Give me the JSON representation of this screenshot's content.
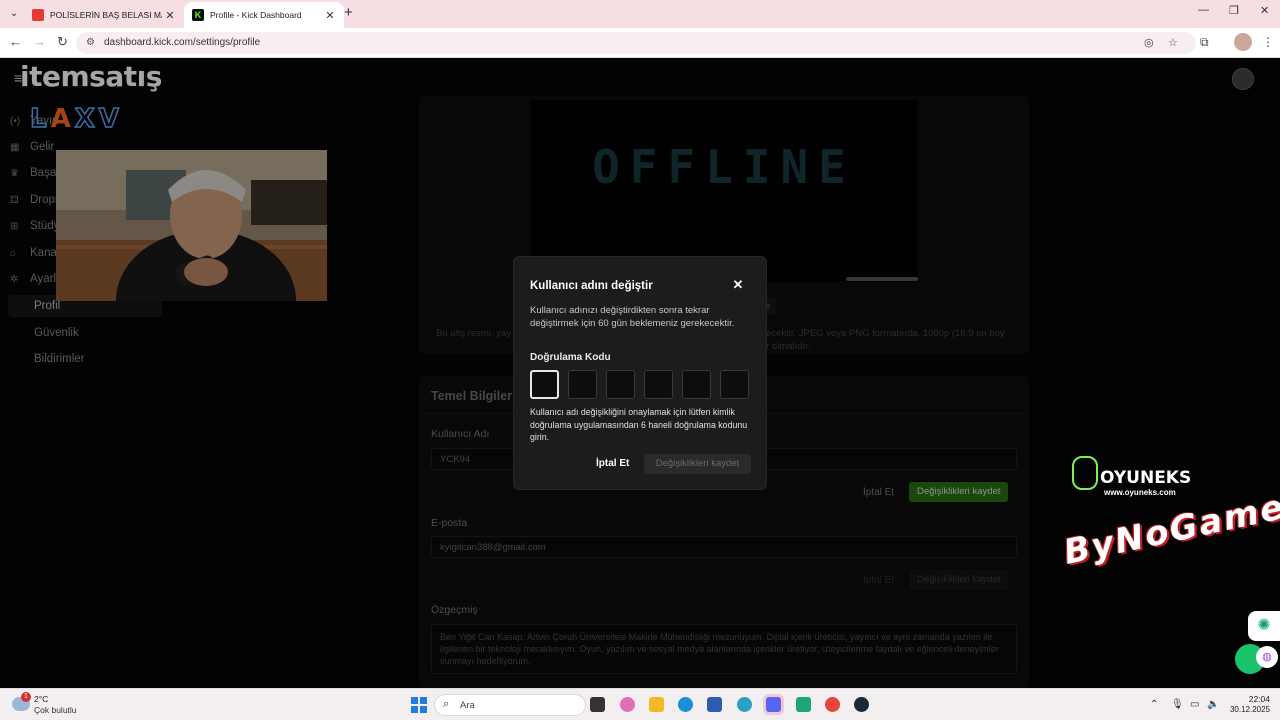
{
  "browser": {
    "tabs": [
      {
        "title": "POLİSLERİN BAŞ BELASI MAHMU",
        "icon": "youtube-icon"
      },
      {
        "title": "Profile - Kick Dashboard",
        "icon": "kick-icon"
      }
    ],
    "new_tab": "+",
    "url": "dashboard.kick.com/settings/profile"
  },
  "sidebar": {
    "items": [
      {
        "label": "Yayın",
        "icon": "broadcast-icon"
      },
      {
        "label": "Gelir",
        "icon": "chart-icon"
      },
      {
        "label": "Başarılar",
        "icon": "trophy-icon"
      },
      {
        "label": "Drops",
        "icon": "drops-icon"
      },
      {
        "label": "Stüdyo",
        "icon": "studio-icon"
      },
      {
        "label": "Kanal",
        "icon": "channel-icon"
      },
      {
        "label": "Ayarlar",
        "icon": "gear-icon"
      }
    ],
    "sub_items": [
      {
        "label": "Profil"
      },
      {
        "label": "Güvenlik"
      },
      {
        "label": "Bildirimler"
      }
    ]
  },
  "overlays": {
    "logo": "itemsatış",
    "laxv_l": "L",
    "laxv_a": "A",
    "laxv_xv": "XV",
    "oyuneks": "OYUNEKS",
    "oyuneks_url": "www.oyuneks.com",
    "bynogame": "ByNoGame"
  },
  "offline_banner": {
    "text": "OFFLINE"
  },
  "profile_page": {
    "banner_note_left": "Bu afiş resmi, yay",
    "banner_note_right": "ecektir. JPEG veya PNG formatında, 1080p (16:9 en boy",
    "banner_note_right2": "r olmalıdır.",
    "banner_btn_fragment": "le",
    "section_title": "Temel Bilgiler",
    "username_label": "Kullanıcı Adı",
    "username_value": "YCK94",
    "cancel": "İptal Et",
    "save": "Değişiklikleri kaydet",
    "email_label": "E-posta",
    "email_value": "kyigitcan388@gmail.com",
    "bio_label": "Özgeçmiş",
    "bio_value": "Ben Yiğit Can Kasap. Artvin Çoruh Üniversitesi Makine Mühendisliği mezunuyum. Dijital içerik üreticisi, yayıncı ve aynı zamanda yazılım ile ilgilenen bir teknoloji meraklısıyım. Oyun, yazılım ve sosyal medya alanlarında içerikler üretiyor; izleyicilerime faydalı ve eğlenceli deneyimler sunmayı hedefliyorum."
  },
  "modal": {
    "title": "Kullanıcı adını değiştir",
    "description": "Kullanıcı adınızı değiştirdikten sonra tekrar değiştirmek için 60 gün beklemeniz gerekecektir.",
    "code_label": "Doğrulama Kodu",
    "help": "Kullanıcı adı değişikliğini onaylamak için lütfen kimlik doğrulama uygulamasından 6 haneli doğrulama kodunu girin.",
    "cancel": "İptal Et",
    "save": "Değişiklikleri kaydet"
  },
  "taskbar": {
    "badge": "1",
    "temperature": "2°C",
    "condition": "Çok bulutlu",
    "search_placeholder": "Ara",
    "time": "22:04",
    "date": "30.12.2025"
  }
}
